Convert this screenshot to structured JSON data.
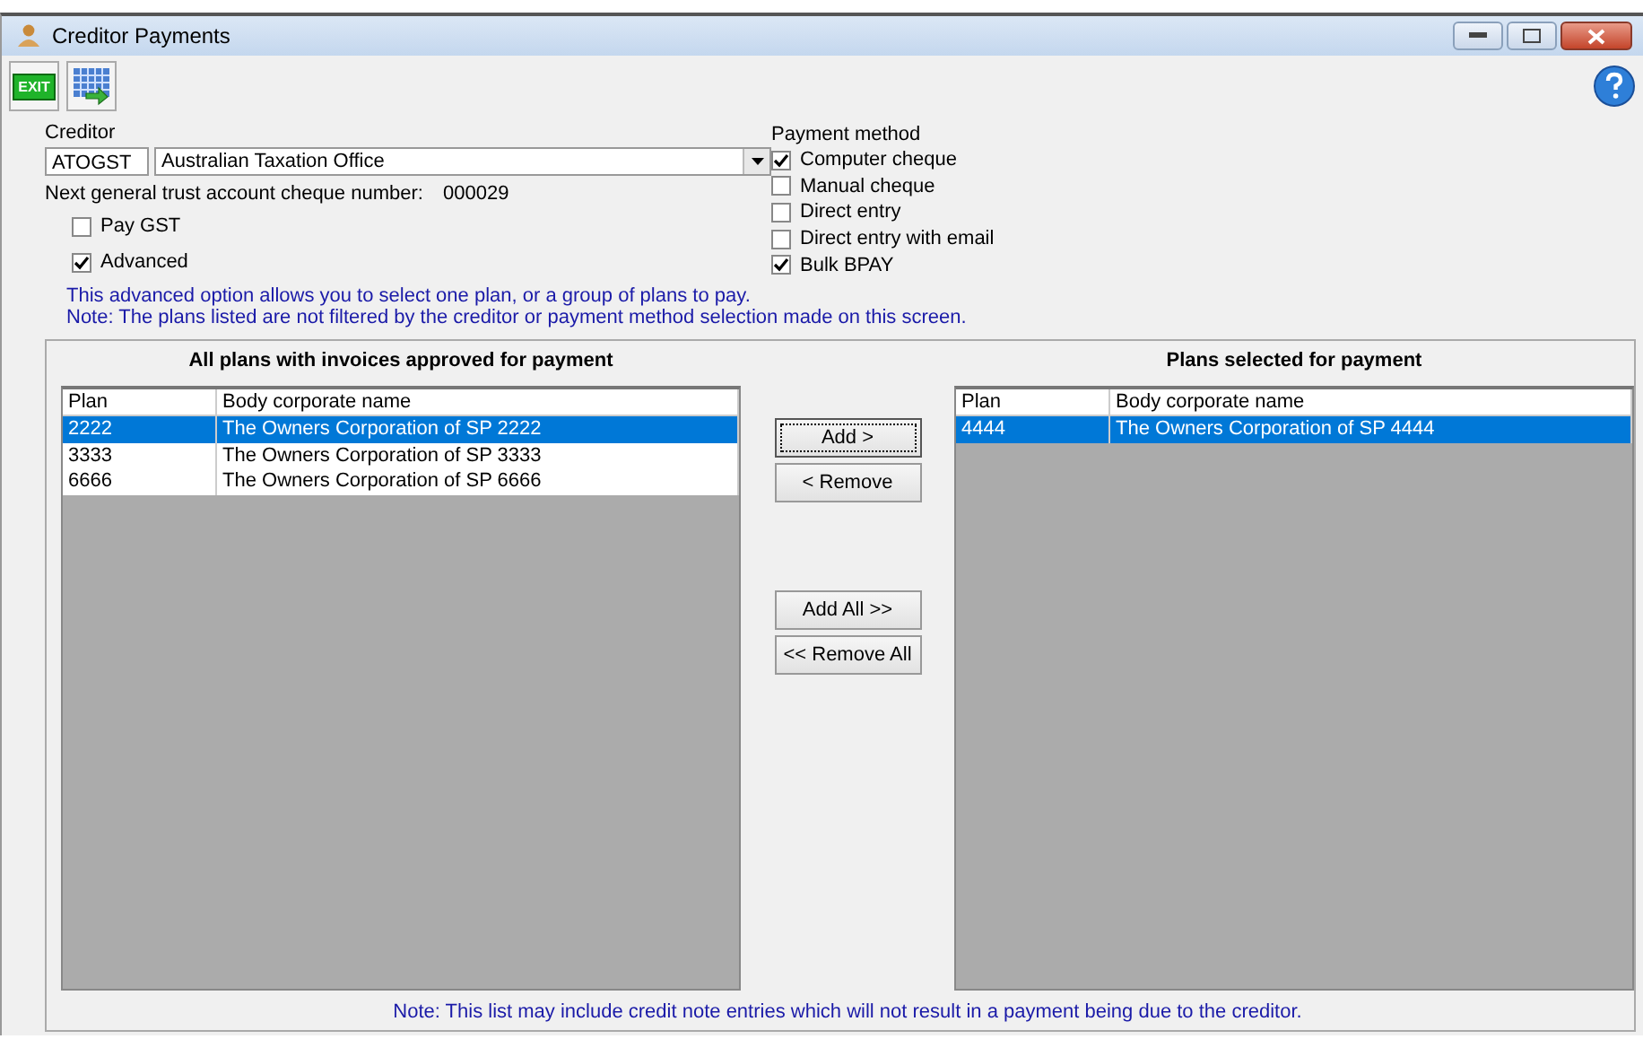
{
  "window": {
    "title": "Creditor Payments"
  },
  "toolbar": [
    {
      "kind": "exit",
      "label": "EXIT"
    },
    {
      "kind": "grid"
    }
  ],
  "creditor": {
    "label": "Creditor",
    "code": "ATOGST",
    "name": "Australian Taxation Office"
  },
  "cheque": {
    "label": "Next general trust account cheque number:",
    "value": "000029"
  },
  "options": [
    {
      "label": "Pay GST",
      "checked": false
    },
    {
      "label": "Advanced",
      "checked": true
    }
  ],
  "payment_method": {
    "label": "Payment method",
    "items": [
      {
        "label": "Computer cheque",
        "checked": true
      },
      {
        "label": "Manual cheque",
        "checked": false
      },
      {
        "label": "Direct entry",
        "checked": false
      },
      {
        "label": "Direct entry with email",
        "checked": false
      },
      {
        "label": "Bulk BPAY",
        "checked": true
      }
    ]
  },
  "info": [
    "This advanced option allows you to select one plan, or a group of plans to pay.",
    "Note: The plans listed are not filtered by the creditor or payment method selection made on this screen."
  ],
  "available": {
    "title": "All plans with invoices approved for payment",
    "columns": [
      "Plan",
      "Body corporate name"
    ],
    "rows": [
      {
        "plan": "2222",
        "name": "The Owners Corporation of SP 2222",
        "selected": true
      },
      {
        "plan": "3333",
        "name": "The Owners Corporation of SP 3333",
        "selected": false
      },
      {
        "plan": "6666",
        "name": "The Owners Corporation of SP 6666",
        "selected": false
      }
    ]
  },
  "buttons": [
    {
      "label": "Add >",
      "focused": true
    },
    {
      "label": "< Remove",
      "focused": false
    },
    {
      "label": "Add All >>",
      "focused": false
    },
    {
      "label": "<< Remove All",
      "focused": false
    }
  ],
  "chosen": {
    "title": "Plans selected for payment",
    "columns": [
      "Plan",
      "Body corporate name"
    ],
    "rows": [
      {
        "plan": "4444",
        "name": "The Owners Corporation of SP 4444",
        "selected": true
      }
    ]
  },
  "footer_note": "Note: This list may include credit note entries which will not result in a payment being due to the creditor."
}
